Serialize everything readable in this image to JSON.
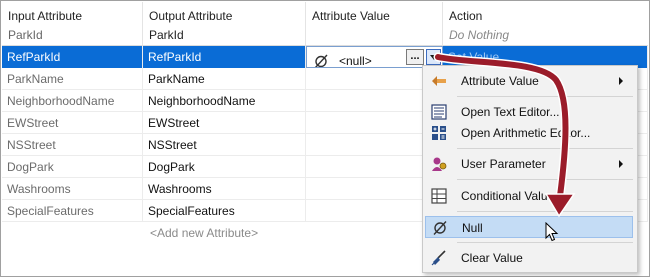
{
  "columns": [
    {
      "title": "Input Attribute",
      "sub": "ParkId"
    },
    {
      "title": "Output Attribute",
      "sub": "ParkId"
    },
    {
      "title": "Attribute Value",
      "sub": ""
    },
    {
      "title": "Action",
      "sub": "Do Nothing"
    }
  ],
  "rows": [
    {
      "input": "RefParkId",
      "output": "RefParkId",
      "value": "<null>",
      "action": "Set Value"
    },
    {
      "input": "ParkName",
      "output": "ParkName",
      "value": "",
      "action": ""
    },
    {
      "input": "NeighborhoodName",
      "output": "NeighborhoodName",
      "value": "",
      "action": ""
    },
    {
      "input": "EWStreet",
      "output": "EWStreet",
      "value": "",
      "action": ""
    },
    {
      "input": "NSStreet",
      "output": "NSStreet",
      "value": "",
      "action": ""
    },
    {
      "input": "DogPark",
      "output": "DogPark",
      "value": "",
      "action": ""
    },
    {
      "input": "Washrooms",
      "output": "Washrooms",
      "value": "",
      "action": ""
    },
    {
      "input": "SpecialFeatures",
      "output": "SpecialFeatures",
      "value": "",
      "action": ""
    }
  ],
  "add_row_label": "<Add new Attribute>",
  "dots_label": "...",
  "menu": {
    "items": [
      {
        "label": "Attribute Value",
        "icon": "attribute-value-icon",
        "submenu": true
      },
      {
        "label": "Open Text Editor...",
        "icon": "text-editor-icon"
      },
      {
        "label": "Open Arithmetic Editor...",
        "icon": "arithmetic-editor-icon"
      },
      {
        "label": "User Parameter",
        "icon": "user-parameter-icon",
        "submenu": true
      },
      {
        "label": "Conditional Value...",
        "icon": "conditional-value-icon"
      },
      {
        "label": "Null",
        "icon": "null-icon",
        "highlighted": true
      },
      {
        "label": "Clear Value",
        "icon": "clear-value-icon"
      }
    ]
  },
  "colors": {
    "selection": "#0a6cd6",
    "menu_highlight": "#c4dcf5",
    "arrow": "#9b1c2a"
  }
}
